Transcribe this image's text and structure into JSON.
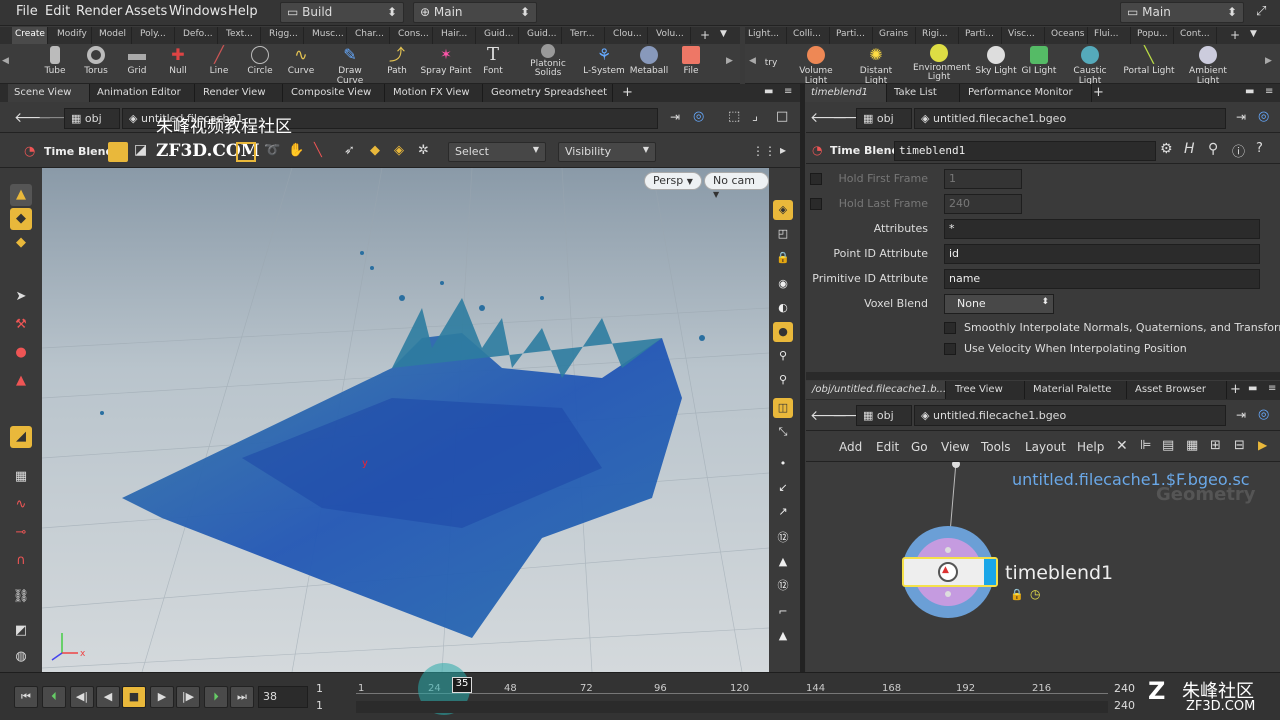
{
  "menubar": {
    "items": [
      "File",
      "Edit",
      "Render",
      "Assets",
      "Windows",
      "Help"
    ],
    "desktop": "Build",
    "context": "Main",
    "right_desktop": "Main"
  },
  "shelf_tabs_left": [
    "Create",
    "Modify",
    "Model",
    "Poly...",
    "Defo...",
    "Text...",
    "Rigg...",
    "Musc...",
    "Char...",
    "Cons...",
    "Hair...",
    "Guid...",
    "Guid...",
    "Terr...",
    "Clou...",
    "Volu..."
  ],
  "shelf_tabs_right": [
    "Light...",
    "Colli...",
    "Parti...",
    "Grains",
    "Rigi...",
    "Parti...",
    "Visc...",
    "Oceans",
    "Flui...",
    "Popu...",
    "Cont..."
  ],
  "shelf_tools_left": [
    "Tube",
    "Torus",
    "Grid",
    "Null",
    "Line",
    "Circle",
    "Curve",
    "Draw Curve",
    "Path",
    "Spray Paint",
    "Font",
    "Platonic Solids",
    "L-System",
    "Metaball",
    "File"
  ],
  "shelf_tools_right": [
    "try",
    "Volume Light",
    "Distant Light",
    "Environment Light",
    "Sky Light",
    "GI Light",
    "Caustic Light",
    "Portal Light",
    "Ambient Light"
  ],
  "pane_tabs_left": [
    "Scene View",
    "Animation Editor",
    "Render View",
    "Composite View",
    "Motion FX View",
    "Geometry Spreadsheet"
  ],
  "pane_tabs_right": [
    "timeblend1",
    "Take List",
    "Performance Monitor"
  ],
  "viewer": {
    "path_root": "obj",
    "path_node": "untitled.filecache1",
    "watermark_cn": "朱峰视频教程社区",
    "watermark_en": "ZF3D.COM",
    "tool_title": "Time Blend",
    "select_label": "Select",
    "visibility_label": "Visibility",
    "persp_label": "Persp",
    "cam_label": "No cam"
  },
  "params": {
    "path_root": "obj",
    "path_node": "untitled.filecache1.bgeo",
    "node_type": "Time Blend",
    "node_name": "timeblend1",
    "rows": [
      {
        "label": "Hold First Frame",
        "value": "1"
      },
      {
        "label": "Hold Last Frame",
        "value": "240"
      },
      {
        "label": "Attributes",
        "value": "*"
      },
      {
        "label": "Point ID Attribute",
        "value": "id"
      },
      {
        "label": "Primitive ID Attribute",
        "value": "name"
      },
      {
        "label": "Voxel Blend",
        "value": "None"
      }
    ],
    "check1": "Smoothly Interpolate Normals, Quaternions, and Transforms",
    "check2": "Use Velocity When Interpolating Position"
  },
  "network_tabs": [
    "/obj/untitled.filecache1.b...",
    "Tree View",
    "Material Palette",
    "Asset Browser"
  ],
  "network": {
    "path_root": "obj",
    "path_node": "untitled.filecache1.bgeo",
    "menu": [
      "Add",
      "Edit",
      "Go",
      "View",
      "Tools",
      "Layout",
      "Help"
    ],
    "file_label": "untitled.filecache1.$F.bgeo.sc",
    "context_label": "Geometry",
    "node_name": "timeblend1"
  },
  "timeline": {
    "current_frame": "38",
    "start": "1",
    "start2": "1",
    "end": "240",
    "end2": "240",
    "ticks": [
      "1",
      "24",
      "35",
      "48",
      "72",
      "96",
      "120",
      "144",
      "168",
      "192",
      "216"
    ],
    "marker": "35"
  },
  "corner_watermark": {
    "cn": "朱峰社区",
    "en": "ZF3D.COM"
  }
}
